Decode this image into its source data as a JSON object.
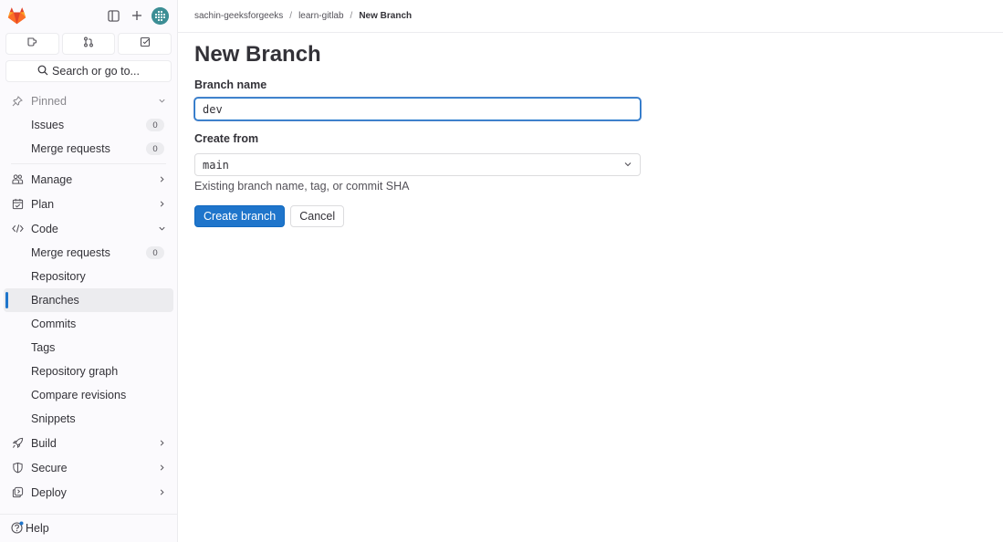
{
  "sidebar": {
    "logo": "gitlab-tanuki-logo",
    "top_icons": [
      "sidebar-toggle-icon",
      "plus-icon",
      "user-avatar"
    ],
    "counters": [
      {
        "name": "issues-counter",
        "icon": "issue-icon"
      },
      {
        "name": "merge-requests-counter",
        "icon": "merge-request-icon"
      },
      {
        "name": "todos-counter",
        "icon": "todo-checkbox-icon"
      }
    ],
    "search_label": "Search or go to...",
    "pinned": {
      "label": "Pinned",
      "items": [
        {
          "label": "Issues",
          "count": "0"
        },
        {
          "label": "Merge requests",
          "count": "0"
        }
      ]
    },
    "sections": {
      "manage": "Manage",
      "plan": "Plan",
      "code": "Code",
      "build": "Build",
      "secure": "Secure",
      "deploy": "Deploy"
    },
    "code_items": [
      {
        "label": "Merge requests",
        "count": "0"
      },
      {
        "label": "Repository"
      },
      {
        "label": "Branches",
        "active": true
      },
      {
        "label": "Commits"
      },
      {
        "label": "Tags"
      },
      {
        "label": "Repository graph"
      },
      {
        "label": "Compare revisions"
      },
      {
        "label": "Snippets"
      }
    ],
    "help_label": "Help"
  },
  "breadcrumb": {
    "items": [
      "sachin-geeksforgeeks",
      "learn-gitlab",
      "New Branch"
    ],
    "separator": "/"
  },
  "page": {
    "title": "New Branch",
    "branch_name_label": "Branch name",
    "branch_name_value": "dev",
    "create_from_label": "Create from",
    "create_from_value": "main",
    "create_from_help": "Existing branch name, tag, or commit SHA",
    "create_button": "Create branch",
    "cancel_button": "Cancel"
  },
  "colors": {
    "primary": "#1f75cb",
    "sidebar_bg": "#fbfafd",
    "active_item_bg": "#ececef",
    "text": "#333238"
  }
}
